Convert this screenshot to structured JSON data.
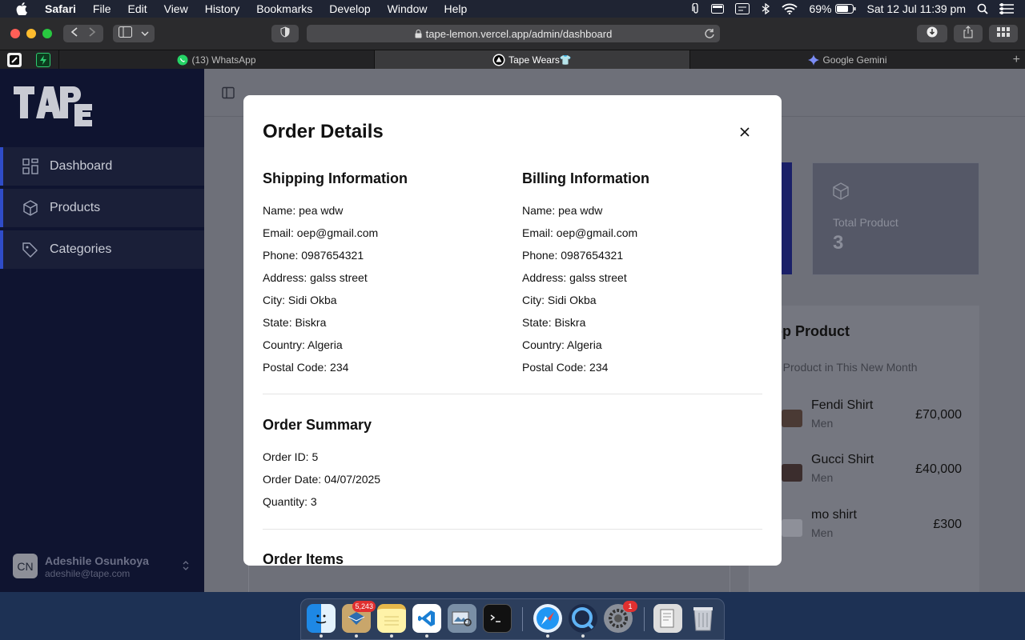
{
  "menubar": {
    "app_name": "Safari",
    "items": [
      "File",
      "Edit",
      "View",
      "History",
      "Bookmarks",
      "Develop",
      "Window",
      "Help"
    ],
    "battery": "69%",
    "datetime": "Sat 12 Jul  11:39 pm"
  },
  "browser": {
    "url": "tape-lemon.vercel.app/admin/dashboard",
    "tabs": [
      {
        "title": "(13) WhatsApp",
        "icon": "whatsapp-icon"
      },
      {
        "title": "Tape Wears👕",
        "icon": "vercel-icon"
      },
      {
        "title": "Google Gemini",
        "icon": "gemini-icon"
      }
    ]
  },
  "sidebar": {
    "logo_text": "TAPE",
    "items": [
      {
        "label": "Dashboard",
        "icon": "grid-icon"
      },
      {
        "label": "Products",
        "icon": "box-icon"
      },
      {
        "label": "Categories",
        "icon": "tag-icon"
      }
    ],
    "user": {
      "initials": "CN",
      "name": "Adeshile Osunkoya",
      "email": "adeshile@tape.com"
    }
  },
  "dashboard": {
    "total_product_label": "Total Product",
    "total_product_value": "3",
    "top_product_title": "op Product",
    "top_product_subtitle": "p Product in This New Month",
    "products": [
      {
        "name": "Fendi Shirt",
        "category": "Men",
        "price": "£70,000"
      },
      {
        "name": "Gucci Shirt",
        "category": "Men",
        "price": "£40,000"
      },
      {
        "name": "mo shirt",
        "category": "Men",
        "price": "£300"
      }
    ]
  },
  "modal": {
    "title": "Order Details",
    "shipping": {
      "heading": "Shipping Information",
      "lines": [
        "Name: pea wdw",
        "Email: oep@gmail.com",
        "Phone: 0987654321",
        "Address: galss street",
        "City: Sidi Okba",
        "State: Biskra",
        "Country: Algeria",
        "Postal Code: 234"
      ]
    },
    "billing": {
      "heading": "Billing Information",
      "lines": [
        "Name: pea wdw",
        "Email: oep@gmail.com",
        "Phone: 0987654321",
        "Address: galss street",
        "City: Sidi Okba",
        "State: Biskra",
        "Country: Algeria",
        "Postal Code: 234"
      ]
    },
    "summary": {
      "heading": "Order Summary",
      "lines": [
        "Order ID: 5",
        "Order Date: 04/07/2025",
        "Quantity: 3"
      ]
    },
    "items_heading": "Order Items"
  },
  "dock": {
    "mail_badge": "5,243",
    "settings_badge": "1"
  }
}
